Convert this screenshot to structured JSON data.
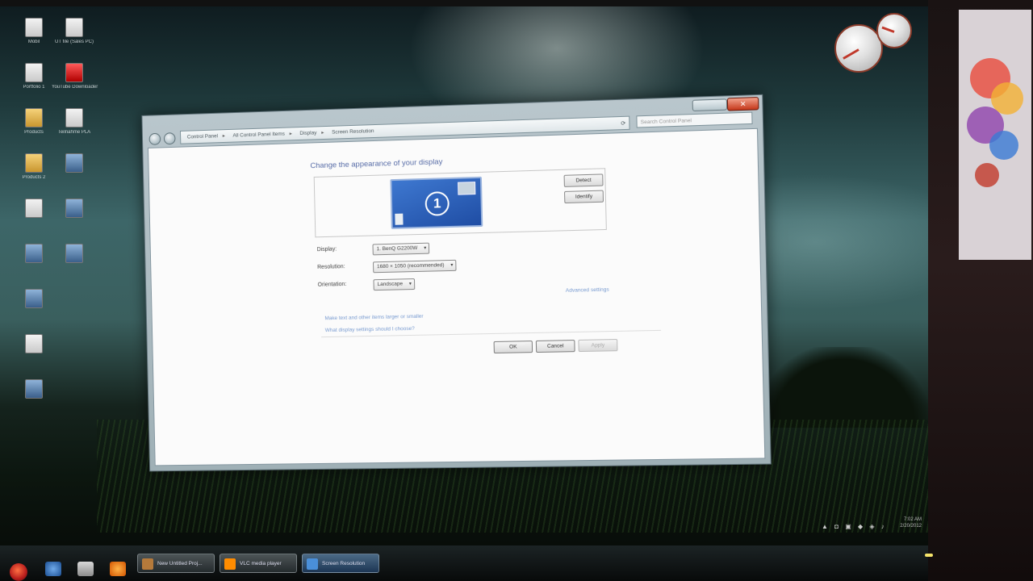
{
  "desktop": {
    "icons_left": [
      {
        "label": "Mobil",
        "icon": "computer-icon"
      },
      {
        "label": "Portfolio 1",
        "icon": "document-icon"
      },
      {
        "label": "Products",
        "icon": "folder-icon"
      },
      {
        "label": "Products 2",
        "icon": "folder-icon"
      },
      {
        "label": "",
        "icon": "document-icon"
      },
      {
        "label": "",
        "icon": "app-icon"
      },
      {
        "label": "",
        "icon": "app-icon"
      },
      {
        "label": "",
        "icon": "document-icon"
      },
      {
        "label": "",
        "icon": "app-icon"
      }
    ],
    "icons_right": [
      {
        "label": "UT file (Sales PC)",
        "icon": "document-icon"
      },
      {
        "label": "YouTube Downloader",
        "icon": "youtube-icon"
      },
      {
        "label": "Teilnahme PLA",
        "icon": "document-icon"
      },
      {
        "label": "",
        "icon": "app-icon"
      },
      {
        "label": "",
        "icon": "app-icon"
      },
      {
        "label": "",
        "icon": "app-icon"
      }
    ]
  },
  "window": {
    "address_crumbs": [
      "Control Panel",
      "All Control Panel Items",
      "Display",
      "Screen Resolution"
    ],
    "search_placeholder": "Search Control Panel",
    "close_glyph": "✕",
    "heading": "Change the appearance of your display",
    "monitor_number": "1",
    "detect_label": "Detect",
    "identify_label": "Identify",
    "display_label": "Display:",
    "display_value": "1. BenQ G2200W",
    "resolution_label": "Resolution:",
    "resolution_value": "1680 × 1050 (recommended)",
    "orientation_label": "Orientation:",
    "orientation_value": "Landscape",
    "advanced_link": "Advanced settings",
    "link_text_size": "Make text and other items larger or smaller",
    "link_settings": "What display settings should I choose?",
    "ok_label": "OK",
    "cancel_label": "Cancel",
    "apply_label": "Apply"
  },
  "taskbar": {
    "tasks": [
      {
        "label": "New Untitled Proj..."
      },
      {
        "label": "VLC media player"
      },
      {
        "label": "Screen Resolution"
      }
    ]
  },
  "tray": {
    "time": "7:02 AM",
    "date": "2/20/2012"
  },
  "colors": {
    "accent_blue": "#2a5db0",
    "close_red": "#c5381b"
  }
}
